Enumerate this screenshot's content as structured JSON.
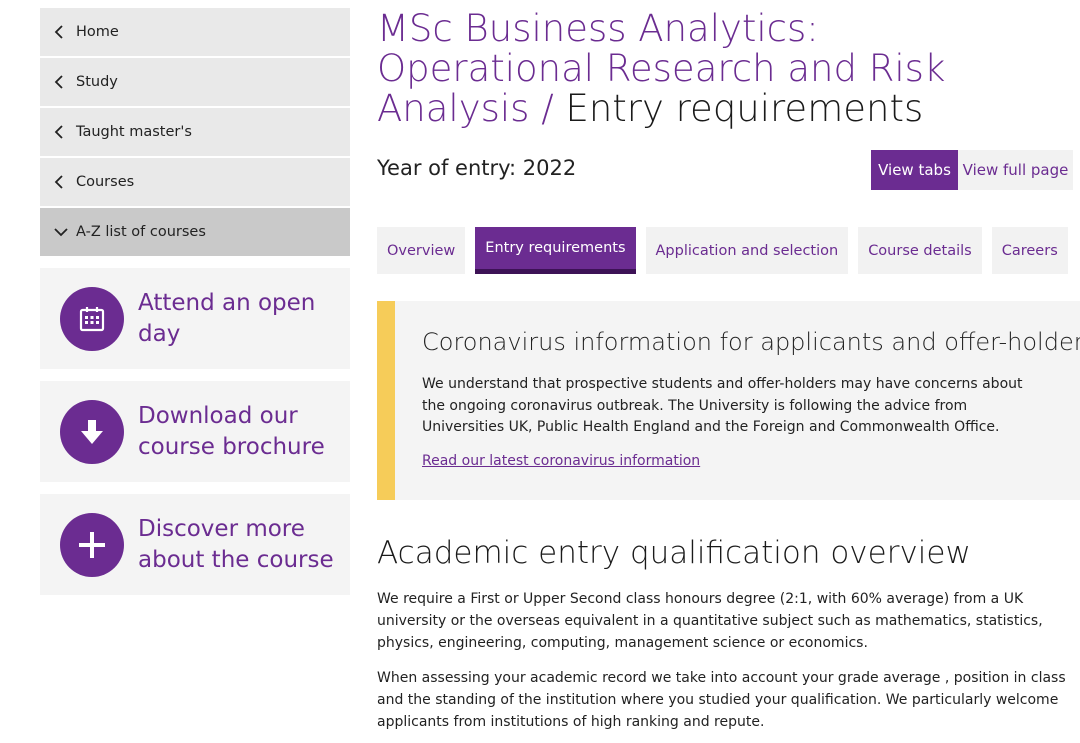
{
  "sidebar": {
    "nav": [
      {
        "label": "Home",
        "icon": "chevron-left-icon"
      },
      {
        "label": "Study",
        "icon": "chevron-left-icon"
      },
      {
        "label": "Taught master's",
        "icon": "chevron-left-icon"
      },
      {
        "label": "Courses",
        "icon": "chevron-left-icon"
      },
      {
        "label": "A-Z list of courses",
        "icon": "chevron-down-icon"
      }
    ],
    "ctas": [
      {
        "label": "Attend an open day",
        "icon": "calendar-icon"
      },
      {
        "label": "Download our course brochure",
        "icon": "download-arrow-icon"
      },
      {
        "label": "Discover more about the course",
        "icon": "plus-icon"
      }
    ]
  },
  "header": {
    "title_part1": "MSc Business Analytics: Operational Research and Risk Analysis",
    "title_sep": " / ",
    "title_part2": "Entry requirements",
    "year": "Year of entry: 2022",
    "view_tabs": "View tabs",
    "view_full": "View full page"
  },
  "tabs": [
    {
      "label": "Overview",
      "active": false
    },
    {
      "label": "Entry requirements",
      "active": true
    },
    {
      "label": "Application and selection",
      "active": false
    },
    {
      "label": "Course details",
      "active": false
    },
    {
      "label": "Careers",
      "active": false
    }
  ],
  "notice": {
    "title": "Coronavirus information for applicants and offer-holders",
    "body": "We understand that prospective students and offer-holders may have concerns about the ongoing coronavirus outbreak. The University is following the advice from Universities UK, Public Health England and the Foreign and Commonwealth Office.",
    "link": "Read our latest coronavirus information"
  },
  "content": {
    "section_title": "Academic entry qualification overview",
    "para1": "We require a First or Upper Second class honours degree (2:1, with 60% average) from a UK university or the overseas equivalent in a quantitative subject such as mathematics, statistics, physics, engineering, computing, management science or economics.",
    "para2": "When assessing your academic record we take into account your grade average , position in class and the standing of the institution where you studied your qualification.  We particularly welcome applicants from institutions of high ranking and repute."
  },
  "colors": {
    "brand_purple": "#6b2c91",
    "notice_accent": "#f6cc59",
    "panel_grey": "#f4f4f4"
  }
}
